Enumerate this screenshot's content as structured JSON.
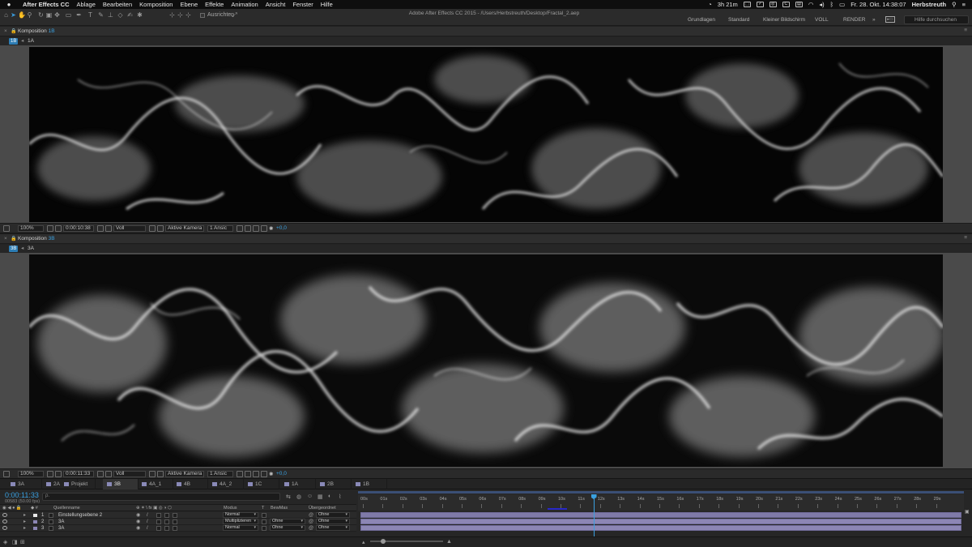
{
  "menubar": {
    "app": "After Effects CC",
    "items": [
      "Ablage",
      "Bearbeiten",
      "Komposition",
      "Ebene",
      "Effekte",
      "Animation",
      "Ansicht",
      "Fenster",
      "Hilfe"
    ],
    "battery": "3h 21m",
    "clock": "Fr. 28. Okt.  14:38:07",
    "user": "Herbstreuth"
  },
  "toolbar": {
    "snap_label": "Ausrichten",
    "window_title": "Adobe After Effects CC 2015 - /Users/Herbstreuth/Desktop/Fractal_2.aep",
    "workspaces": [
      "Grundlagen",
      "Standard",
      "Kleiner Bildschirm",
      "VOLL",
      "RENDER"
    ],
    "help_placeholder": "Hilfe durchsuchen"
  },
  "viewer1": {
    "title_prefix": "Komposition",
    "title_comp": "1B",
    "crumb_num": "1B",
    "crumb_name": "1A",
    "zoom": "100%",
    "timecode": "0:00:10:38",
    "resolution": "Voll",
    "camera": "Aktive Kamera",
    "views": "1 Ansic",
    "exposure": "+0,0"
  },
  "viewer2": {
    "title_prefix": "Komposition",
    "title_comp": "3B",
    "crumb_num": "3B",
    "crumb_name": "3A",
    "zoom": "100%",
    "timecode": "0:00:11:33",
    "resolution": "Voll",
    "camera": "Aktive Kamera",
    "views": "1 Ansic",
    "exposure": "+0,0"
  },
  "comp_tabs": [
    {
      "label": "3A",
      "active": false
    },
    {
      "label": "2A",
      "active": false
    },
    {
      "label": "Projekt",
      "active": false
    },
    {
      "label": "3B",
      "active": true
    },
    {
      "label": "4A_1",
      "active": false
    },
    {
      "label": "4B",
      "active": false
    },
    {
      "label": "4A_2",
      "active": false
    },
    {
      "label": "1C",
      "active": false
    },
    {
      "label": "1A",
      "active": false
    },
    {
      "label": "2B",
      "active": false
    },
    {
      "label": "1B",
      "active": false
    }
  ],
  "timeline": {
    "timecode": "0:00:11:33",
    "frames": "00583 (50.00 fps)",
    "search_placeholder": "ρ.",
    "columns": {
      "name": "Quellenname",
      "mode": "Modus",
      "t": "T",
      "trkmat": "BewMas",
      "parent": "Übergeordnet"
    },
    "ruler": [
      "00s",
      "01s",
      "02s",
      "03s",
      "04s",
      "05s",
      "06s",
      "07s",
      "08s",
      "09s",
      "10s",
      "11s",
      "12s",
      "13s",
      "14s",
      "15s",
      "16s",
      "17s",
      "18s",
      "19s",
      "20s",
      "21s",
      "22s",
      "23s",
      "24s",
      "25s",
      "26s",
      "27s",
      "28s",
      "29s"
    ],
    "current_time_sec": 11.66,
    "layers": [
      {
        "num": "1",
        "name": "Einstellungsebene 2",
        "color": "#e8e8e8",
        "mode": "Normal",
        "trkmat": "",
        "parent": "Ohne"
      },
      {
        "num": "2",
        "name": "3A",
        "color": "#8c86b4",
        "mode": "Multiplizieren",
        "trkmat": "Ohne",
        "parent": "Ohne"
      },
      {
        "num": "3",
        "name": "3A",
        "color": "#8c86b4",
        "mode": "Normal",
        "trkmat": "Ohne",
        "parent": "Ohne"
      }
    ]
  },
  "colors": {
    "accent": "#3aa0e0",
    "layer_bar": "#8c86b4",
    "panel": "#2b2b2b"
  }
}
